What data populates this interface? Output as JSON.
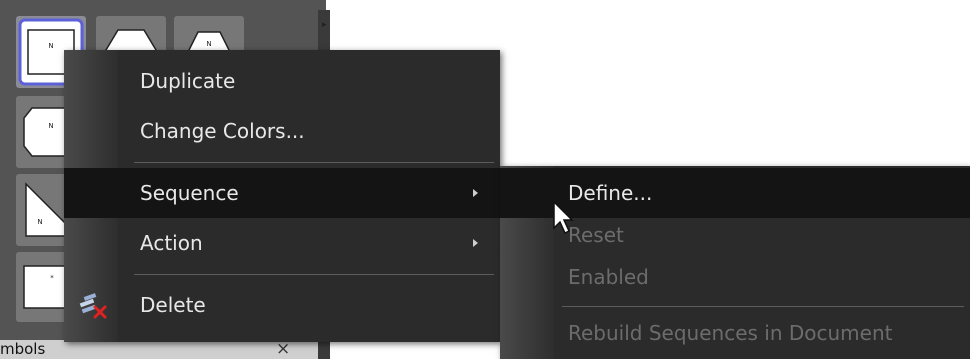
{
  "palette": {
    "title": "mbols",
    "close_label": "×"
  },
  "context_menu": {
    "items": [
      {
        "label": "Duplicate"
      },
      {
        "label": "Change Colors..."
      },
      {
        "label": "Sequence"
      },
      {
        "label": "Action"
      },
      {
        "label": "Delete",
        "icon": "delete-symbol-icon"
      }
    ]
  },
  "submenu": {
    "items": [
      {
        "label": "Define..."
      },
      {
        "label": "Reset"
      },
      {
        "label": "Enabled"
      },
      {
        "label": "Rebuild Sequences in Document"
      }
    ]
  },
  "colors": {
    "menu_bg": "#2b2b2b",
    "highlight_bg": "#141414",
    "text": "#e8e8e8",
    "disabled_text": "#6c6c6c",
    "selection_border": "#5d61d8"
  }
}
